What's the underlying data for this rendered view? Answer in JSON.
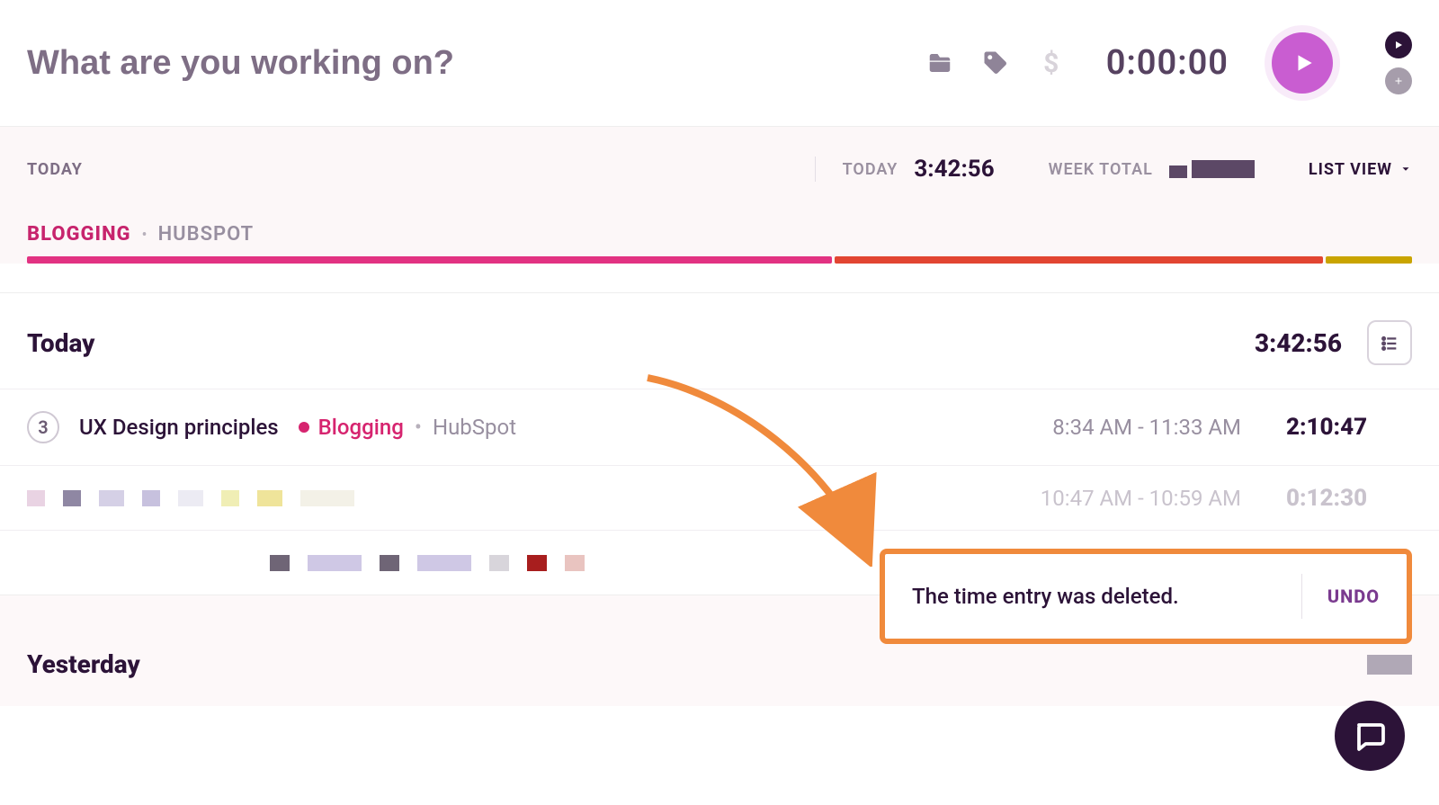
{
  "timer": {
    "placeholder": "What are you working on?",
    "display": "0:00:00"
  },
  "summary": {
    "today_label": "TODAY",
    "today_label2": "TODAY",
    "today_value": "3:42:56",
    "week_label": "WEEK TOTAL",
    "list_view_label": "LIST VIEW",
    "project": {
      "name": "BLOGGING",
      "client": "HUBSPOT"
    },
    "segments": [
      {
        "color": "#e23282",
        "width": 56
      },
      {
        "color": "#e24532",
        "width": 34
      },
      {
        "color": "#c9a400",
        "width": 6
      }
    ],
    "week_bars": [
      14,
      20,
      20
    ]
  },
  "day": {
    "title": "Today",
    "total": "3:42:56",
    "entries": [
      {
        "count": "3",
        "title": "UX Design principles",
        "project": "Blogging",
        "client": "HubSpot",
        "time_range": "8:34 AM - 11:33 AM",
        "duration": "2:10:47"
      }
    ],
    "blurred_entry": {
      "time_range": "10:47 AM - 10:59 AM",
      "duration": "0:12:30"
    }
  },
  "yesterday": {
    "title": "Yesterday"
  },
  "toast": {
    "message": "The time entry was deleted.",
    "undo": "UNDO"
  }
}
